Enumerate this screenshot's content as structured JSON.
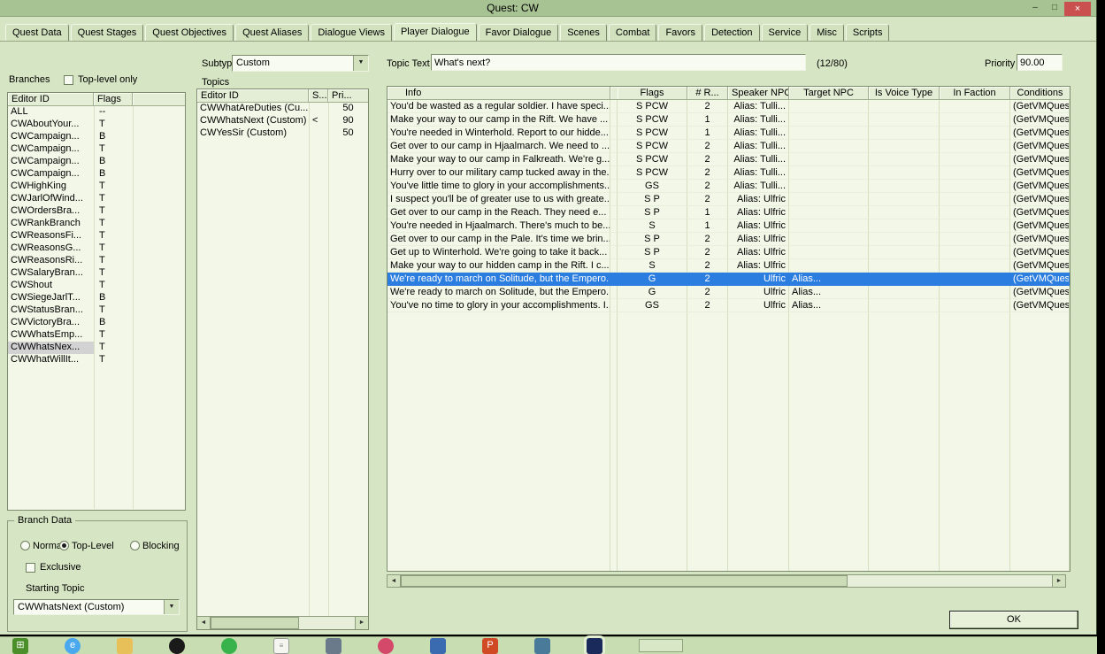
{
  "window": {
    "title": "Quest: CW",
    "controls": {
      "minimize": "–",
      "maximize": "□",
      "close": "×"
    }
  },
  "icons": {
    "scroll_left": "◄",
    "scroll_right": "►",
    "dropdown": "▼"
  },
  "tabs": [
    {
      "label": "Quest Data"
    },
    {
      "label": "Quest Stages"
    },
    {
      "label": "Quest Objectives"
    },
    {
      "label": "Quest Aliases"
    },
    {
      "label": "Dialogue Views"
    },
    {
      "label": "Player Dialogue",
      "active": true
    },
    {
      "label": "Favor Dialogue"
    },
    {
      "label": "Scenes"
    },
    {
      "label": "Combat"
    },
    {
      "label": "Favors"
    },
    {
      "label": "Detection"
    },
    {
      "label": "Service"
    },
    {
      "label": "Misc"
    },
    {
      "label": "Scripts"
    }
  ],
  "branches": {
    "label": "Branches",
    "top_level_only_label": "Top-level only",
    "top_level_only_checked": false,
    "columns": [
      "Editor ID",
      "Flags"
    ],
    "selected_index": 19,
    "rows": [
      [
        "ALL",
        "--"
      ],
      [
        "CWAboutYour...",
        "T"
      ],
      [
        "CWCampaign...",
        "B"
      ],
      [
        "CWCampaign...",
        "T"
      ],
      [
        "CWCampaign...",
        "B"
      ],
      [
        "CWCampaign...",
        "B"
      ],
      [
        "CWHighKing",
        "T"
      ],
      [
        "CWJarlOfWind...",
        "T"
      ],
      [
        "CWOrdersBra...",
        "T"
      ],
      [
        "CWRankBranch",
        "T"
      ],
      [
        "CWReasonsFi...",
        "T"
      ],
      [
        "CWReasonsG...",
        "T"
      ],
      [
        "CWReasonsRi...",
        "T"
      ],
      [
        "CWSalaryBran...",
        "T"
      ],
      [
        "CWShout",
        "T"
      ],
      [
        "CWSiegeJarlT...",
        "B"
      ],
      [
        "CWStatusBran...",
        "T"
      ],
      [
        "CWVictoryBra...",
        "B"
      ],
      [
        "CWWhatsEmp...",
        "T"
      ],
      [
        "CWWhatsNex...",
        "T"
      ],
      [
        "CWWhatWillIt...",
        "T"
      ]
    ]
  },
  "branch_data": {
    "title": "Branch Data",
    "radios": [
      {
        "label": "Normal",
        "selected": false
      },
      {
        "label": "Top-Level",
        "selected": true
      },
      {
        "label": "Blocking",
        "selected": false
      }
    ],
    "exclusive_label": "Exclusive",
    "exclusive_checked": false,
    "starting_topic_label": "Starting Topic",
    "starting_topic_value": "CWWhatsNext (Custom)"
  },
  "subtype": {
    "label": "Subtype",
    "value": "Custom"
  },
  "topics": {
    "label": "Topics",
    "columns": [
      "Editor ID",
      "S...",
      "Pri..."
    ],
    "rows": [
      {
        "editor_id": "CWWhatAreDuties (Cu...",
        "s": "",
        "pri": "50"
      },
      {
        "editor_id": "CWWhatsNext (Custom)",
        "s": "<",
        "pri": "90"
      },
      {
        "editor_id": "CWYesSir (Custom)",
        "s": "",
        "pri": "50"
      }
    ]
  },
  "topic_text": {
    "label": "Topic Text",
    "value": "What's next?",
    "counter": "(12/80)"
  },
  "priority": {
    "label": "Priority",
    "value": "90.00"
  },
  "info_table": {
    "columns": [
      "Info",
      "Flags",
      "# R...",
      "Speaker NPC",
      "Target NPC",
      "Is Voice Type",
      "In Faction",
      "Conditions"
    ],
    "selected_index": 13,
    "rows": [
      {
        "info": "You'd be wasted as a regular soldier. I have speci...",
        "flags": "S PCW",
        "responses": "2",
        "speaker": "Alias: Tulli...",
        "target": "",
        "voice_type": "",
        "faction": "",
        "conditions": "(GetVMQues"
      },
      {
        "info": "Make your way to our camp in the Rift. We have ...",
        "flags": "S PCW",
        "responses": "1",
        "speaker": "Alias: Tulli...",
        "target": "",
        "voice_type": "",
        "faction": "",
        "conditions": "(GetVMQues"
      },
      {
        "info": "You're needed in Winterhold. Report to our hidde...",
        "flags": "S PCW",
        "responses": "1",
        "speaker": "Alias: Tulli...",
        "target": "",
        "voice_type": "",
        "faction": "",
        "conditions": "(GetVMQues"
      },
      {
        "info": "Get over to our camp in Hjaalmarch. We need to ...",
        "flags": "S PCW",
        "responses": "2",
        "speaker": "Alias: Tulli...",
        "target": "",
        "voice_type": "",
        "faction": "",
        "conditions": "(GetVMQues"
      },
      {
        "info": "Make your way to our camp in Falkreath. We're g...",
        "flags": "S PCW",
        "responses": "2",
        "speaker": "Alias: Tulli...",
        "target": "",
        "voice_type": "",
        "faction": "",
        "conditions": "(GetVMQues"
      },
      {
        "info": "Hurry over to our military camp tucked away in the...",
        "flags": "S PCW",
        "responses": "2",
        "speaker": "Alias: Tulli...",
        "target": "",
        "voice_type": "",
        "faction": "",
        "conditions": "(GetVMQues"
      },
      {
        "info": "You've little time to glory in your accomplishments...",
        "flags": "GS",
        "responses": "2",
        "speaker": "Alias: Tulli...",
        "target": "",
        "voice_type": "",
        "faction": "",
        "conditions": "(GetVMQues"
      },
      {
        "info": "I suspect you'll be of greater use to us with greate...",
        "flags": "S P",
        "responses": "2",
        "speaker": "Alias: Ulfric",
        "target": "",
        "voice_type": "",
        "faction": "",
        "conditions": "(GetVMQues"
      },
      {
        "info": "Get over to our camp in the Reach. They need e...",
        "flags": "S P",
        "responses": "1",
        "speaker": "Alias: Ulfric",
        "target": "",
        "voice_type": "",
        "faction": "",
        "conditions": "(GetVMQues"
      },
      {
        "info": "You're needed in Hjaalmarch. There's much to be...",
        "flags": "S",
        "responses": "1",
        "speaker": "Alias: Ulfric",
        "target": "",
        "voice_type": "",
        "faction": "",
        "conditions": "(GetVMQues"
      },
      {
        "info": "Get over to our camp in the Pale. It's time we brin...",
        "flags": "S P",
        "responses": "2",
        "speaker": "Alias: Ulfric",
        "target": "",
        "voice_type": "",
        "faction": "",
        "conditions": "(GetVMQues"
      },
      {
        "info": "Get up to Winterhold. We're going to take it back...",
        "flags": "S P",
        "responses": "2",
        "speaker": "Alias: Ulfric",
        "target": "",
        "voice_type": "",
        "faction": "",
        "conditions": "(GetVMQues"
      },
      {
        "info": "Make your way to our hidden camp in the Rift. I c...",
        "flags": "S",
        "responses": "2",
        "speaker": "Alias: Ulfric",
        "target": "",
        "voice_type": "",
        "faction": "",
        "conditions": "(GetVMQues"
      },
      {
        "info": "We're ready to march on Solitude, but the Empero...",
        "flags": "G",
        "responses": "2",
        "speaker": "Ulfric",
        "target": "Alias...",
        "voice_type": "",
        "faction": "",
        "conditions": "(GetVMQues"
      },
      {
        "info": "We're ready to march on Solitude, but the Empero...",
        "flags": "G",
        "responses": "2",
        "speaker": "Ulfric",
        "target": "Alias...",
        "voice_type": "",
        "faction": "",
        "conditions": "(GetVMQues"
      },
      {
        "info": "You've no time to glory in your accomplishments. I...",
        "flags": "GS",
        "responses": "2",
        "speaker": "Ulfric",
        "target": "Alias...",
        "voice_type": "",
        "faction": "",
        "conditions": "(GetVMQues"
      }
    ]
  },
  "ok_label": "OK",
  "taskbar": {
    "icons": [
      {
        "name": "start-button",
        "glyph": "⊞",
        "bg": "#4a8f29",
        "fg": "#ffffff",
        "shape": "square"
      },
      {
        "name": "browser-icon",
        "glyph": "e",
        "bg": "#49a8ee",
        "fg": "#ffffff",
        "shape": "circle"
      },
      {
        "name": "folder-icon",
        "glyph": "",
        "bg": "#e8c05a",
        "fg": "#ffffff",
        "shape": "square"
      },
      {
        "name": "app-icon-dark",
        "glyph": "",
        "bg": "#1a1a1a",
        "fg": "#ffffff",
        "shape": "circle"
      },
      {
        "name": "app-icon-green",
        "glyph": "",
        "bg": "#38b24a",
        "fg": "#ffffff",
        "shape": "circle"
      },
      {
        "name": "document-icon",
        "glyph": "≡",
        "bg": "#f5f5f0",
        "fg": "#888888",
        "shape": "doc"
      },
      {
        "name": "app-icon-gray",
        "glyph": "",
        "bg": "#6a7a8a",
        "fg": "#ffffff",
        "shape": "square"
      },
      {
        "name": "app-icon-red",
        "glyph": "",
        "bg": "#d4496a",
        "fg": "#ffffff",
        "shape": "circle"
      },
      {
        "name": "app-icon-blue",
        "glyph": "",
        "bg": "#3a6ab0",
        "fg": "#ffffff",
        "shape": "square"
      },
      {
        "name": "powerpoint-icon",
        "glyph": "P",
        "bg": "#d04a23",
        "fg": "#ffffff",
        "shape": "square"
      },
      {
        "name": "app-icon-steel",
        "glyph": "",
        "bg": "#4a7a9a",
        "fg": "#ffffff",
        "shape": "square"
      },
      {
        "name": "app-icon-navy",
        "glyph": "",
        "bg": "#1a2a5a",
        "fg": "#ffffff",
        "shape": "square",
        "active": true
      },
      {
        "name": "open-window-button",
        "glyph": "",
        "bg": "#d8e7c6",
        "fg": "#000000",
        "shape": "wide"
      }
    ]
  }
}
